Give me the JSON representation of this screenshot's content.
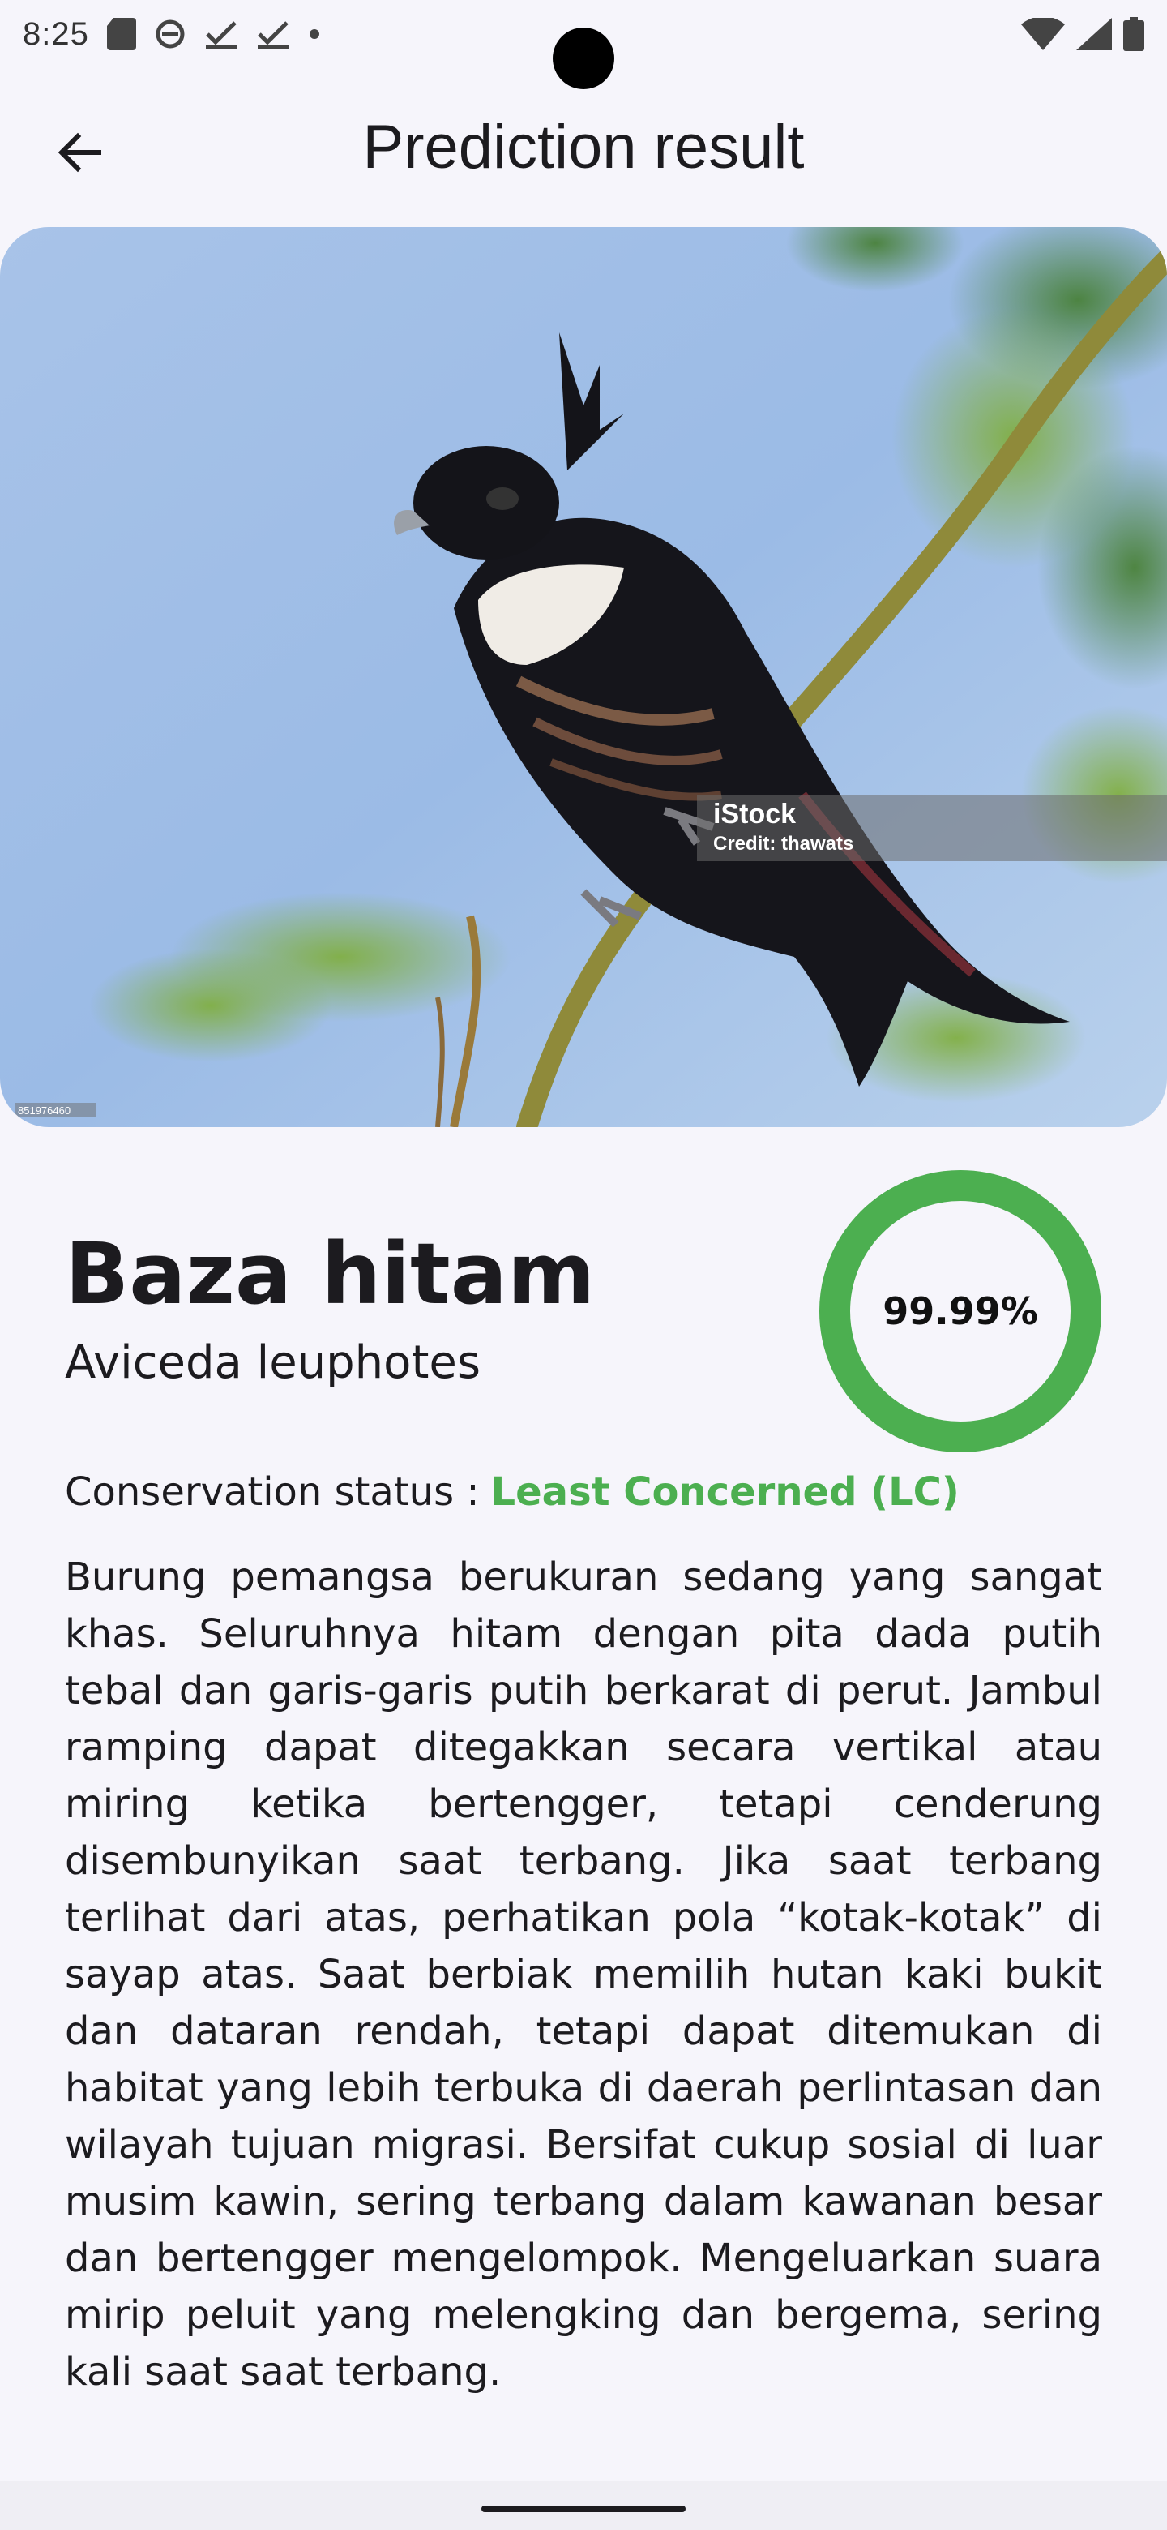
{
  "status_bar": {
    "time": "8:25"
  },
  "app_bar": {
    "title": "Prediction result",
    "back_icon": "arrow-back-icon"
  },
  "hero_image": {
    "watermark_brand": "iStock",
    "watermark_credit": "Credit: thawats",
    "image_id": "851976460"
  },
  "result": {
    "common_name": "Baza hitam",
    "scientific_name": "Aviceda leuphotes",
    "confidence_text": "99.99%",
    "confidence_fraction": 0.9999,
    "ring_color": "#4caf50"
  },
  "conservation": {
    "label": "Conservation status :",
    "value": "Least Concerned (LC)",
    "value_color": "#4caf50"
  },
  "description": "Burung pemangsa berukuran sedang yang sangat khas. Seluruhnya hitam dengan pita dada putih tebal dan garis-garis putih berkarat di perut. Jambul ramping dapat ditegakkan secara vertikal atau miring ketika bertengger, tetapi cenderung disembunyikan saat terbang. Jika saat terbang terlihat dari atas, perhatikan pola “kotak-kotak” di sayap atas. Saat berbiak memilih hutan kaki bukit dan dataran rendah, tetapi dapat ditemukan di habitat yang lebih terbuka di daerah perlintasan dan wilayah tujuan migrasi. Bersifat cukup sosial di luar musim kawin, sering terbang dalam kawanan besar dan bertengger mengelompok. Mengeluarkan suara mirip peluit yang melengking dan bergema, sering kali saat saat terbang."
}
